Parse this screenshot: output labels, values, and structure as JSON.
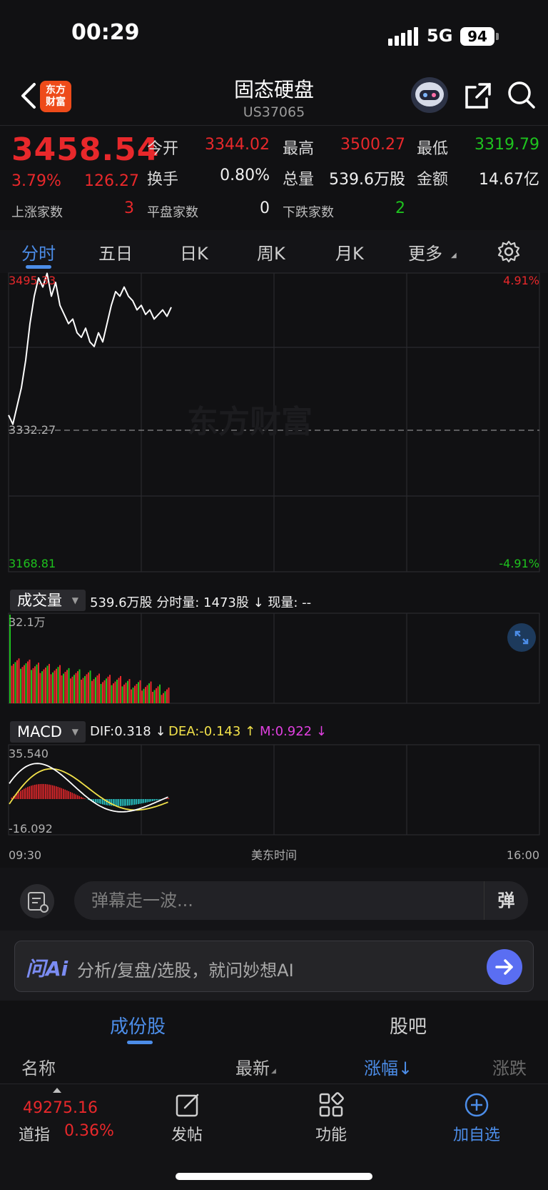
{
  "status_bar": {
    "time": "00:29",
    "network": "5G",
    "battery": "94"
  },
  "header": {
    "logo_text": "东方\n财富",
    "title": "固态硬盘",
    "code": "US37065"
  },
  "quote": {
    "price": "3458.54",
    "change_pct": "3.79%",
    "change": "126.27",
    "open_label": "今开",
    "open": "3344.02",
    "high_label": "最高",
    "high": "3500.27",
    "low_label": "最低",
    "low": "3319.79",
    "turnover_label": "换手",
    "turnover": "0.80%",
    "volume_label": "总量",
    "volume": "539.6万股",
    "amount_label": "金额",
    "amount": "14.67亿",
    "up_label": "上涨家数",
    "up": "3",
    "flat_label": "平盘家数",
    "flat": "0",
    "down_label": "下跌家数",
    "down": "2"
  },
  "tabs": [
    "分时",
    "五日",
    "日K",
    "周K",
    "月K",
    "更多"
  ],
  "chart": {
    "watermark": "东方财富",
    "price_high": "3495.33",
    "price_prev": "3332.27",
    "price_low": "3168.81",
    "pct_high": "4.91%",
    "pct_low": "-4.91%",
    "volume_indicator": "成交量",
    "volume_info": "539.6万股  分时量: 1473股 ↓  现量: --",
    "volume_max": "32.1万",
    "macd_indicator": "MACD",
    "dif": "DIF:0.318 ↓",
    "dea": "DEA:-0.143 ↑",
    "m": "M:0.922 ↓",
    "macd_high": "35.540",
    "macd_low": "-16.092",
    "time_start": "09:30",
    "time_label": "美东时间",
    "time_end": "16:00"
  },
  "chart_data": {
    "type": "line",
    "title": "",
    "x": [
      "09:30",
      "16:00"
    ],
    "series": [
      {
        "name": "price",
        "values": [
          3340,
          3330,
          3350,
          3370,
          3400,
          3440,
          3470,
          3490,
          3480,
          3495,
          3470,
          3485,
          3460,
          3450,
          3440,
          3445,
          3430,
          3425,
          3435,
          3420,
          3415,
          3430,
          3420,
          3440,
          3460,
          3475,
          3470,
          3480,
          3470,
          3465,
          3455,
          3460,
          3450,
          3455,
          3445,
          3450,
          3455,
          3448,
          3458
        ]
      }
    ],
    "ylim": [
      3168.81,
      3495.33
    ],
    "prev_close": 3332.27,
    "volume_ylim": [
      0,
      321000
    ],
    "macd_ylim": [
      -16.092,
      35.54
    ],
    "colors": {
      "up": "#e8282b",
      "down": "#1ec31e",
      "line": "#ffffff",
      "dif": "#ffffff",
      "dea": "#f2e24a",
      "macd_neg": "#2ad0d0"
    }
  },
  "danmaku": {
    "placeholder": "弹幕走一波...",
    "button": "弹"
  },
  "ask_ai": {
    "logo": "问Ai",
    "placeholder": "分析/复盘/选股，就问妙想AI"
  },
  "sections": {
    "tab1": "成份股",
    "tab2": "股吧"
  },
  "columns": {
    "name": "名称",
    "latest": "最新",
    "change_pct": "涨幅↓",
    "change": "涨跌"
  },
  "bottom_nav": {
    "index_value": "49275.16",
    "index_name": "道指",
    "index_pct": "0.36%",
    "post": "发帖",
    "features": "功能",
    "add": "加自选"
  }
}
